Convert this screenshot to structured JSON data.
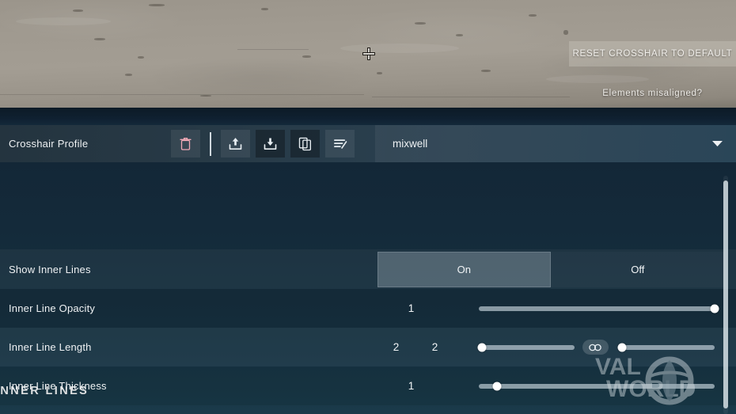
{
  "preview": {
    "reset_button_label": "RESET CROSSHAIR TO DEFAULT",
    "misaligned_link": "Elements misaligned?",
    "crosshair_icon": "crosshair-plus-icon"
  },
  "profile_bar": {
    "label": "Crosshair Profile",
    "tools": [
      {
        "name": "delete-profile-button",
        "icon": "trash-icon",
        "color": "#f0a9b6"
      },
      {
        "name": "import-profile-button",
        "icon": "upload-icon",
        "color": "#e8eef2"
      },
      {
        "name": "export-profile-button",
        "icon": "download-icon",
        "color": "#e8eef2"
      },
      {
        "name": "duplicate-profile-button",
        "icon": "copy-icon",
        "color": "#e8eef2"
      },
      {
        "name": "rename-profile-button",
        "icon": "edit-list-icon",
        "color": "#e8eef2"
      }
    ],
    "selected_profile": "mixwell",
    "dropdown_icon": "chevron-down-icon"
  },
  "section": {
    "title": "INNER LINES"
  },
  "rows": {
    "show_inner_lines": {
      "label": "Show Inner Lines",
      "options": [
        "On",
        "Off"
      ],
      "selected": "On"
    },
    "inner_line_opacity": {
      "label": "Inner Line Opacity",
      "value": "1",
      "slider_percent": 100
    },
    "inner_line_length": {
      "label": "Inner Line Length",
      "value_1": "2",
      "value_2": "2",
      "slider_1_percent": 4,
      "slider_2_percent": 4,
      "link_icon": "chain-link-icon"
    },
    "inner_line_thickness": {
      "label": "Inner Line Thickness",
      "value": "1",
      "slider_percent": 8
    }
  },
  "watermark": {
    "line_1": "VAL",
    "line_2": "WORLD"
  },
  "colors": {
    "panel_bg": "#16303f",
    "bar_bg": "#2a4050",
    "accent_text": "#eef1f3",
    "delete_red": "#f0a9b6",
    "slider_track": "#d2dee6"
  }
}
